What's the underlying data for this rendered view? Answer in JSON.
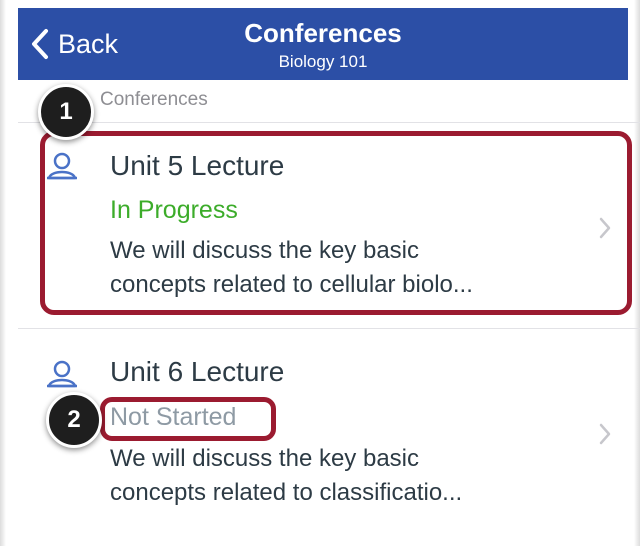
{
  "navbar": {
    "back_label": "Back",
    "title": "Conferences",
    "subtitle": "Biology 101",
    "background": "#2c4fa6"
  },
  "section": {
    "header": "Conferences"
  },
  "conferences": [
    {
      "title": "Unit 5 Lecture",
      "status": "In Progress",
      "status_color": "#3cac2a",
      "description_line1": "We will discuss the key basic",
      "description_line2": "concepts related to cellular biolo...",
      "icon": "conference-user-icon"
    },
    {
      "title": "Unit 6 Lecture",
      "status": "Not Started",
      "status_color": "#8e9aa4",
      "description_line1": "We will discuss the key basic",
      "description_line2": "concepts related to classificatio...",
      "icon": "conference-user-icon"
    }
  ],
  "callouts": [
    {
      "label": "1"
    },
    {
      "label": "2"
    }
  ],
  "colors": {
    "highlight": "#9b1b30",
    "text": "#2d3b45"
  }
}
